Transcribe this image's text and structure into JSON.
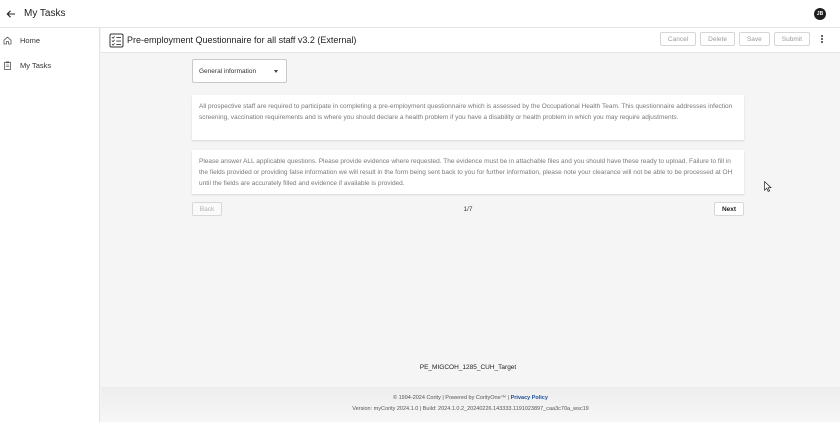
{
  "topbar": {
    "title": "My Tasks",
    "avatar_initials": "JB",
    "back_icon": "arrow-left-icon"
  },
  "sidebar": {
    "items": [
      {
        "label": "Home",
        "icon": "home-icon"
      },
      {
        "label": "My Tasks",
        "icon": "clipboard-icon"
      }
    ]
  },
  "form": {
    "title": "Pre-employment Questionnaire for all staff v3.2 (External)",
    "icon": "form-checklist-icon",
    "actions": {
      "cancel_label": "Cancel",
      "delete_label": "Delete",
      "save_label": "Save",
      "submit_label": "Submit"
    },
    "section_select": {
      "value": "General information"
    },
    "info_text_1": "All prospective staff are required to participate in completing a pre-employment questionnaire which is assessed by the Occupational Health Team. This questionnaire addresses infection screening, vaccination requirements and is where you should declare a health problem if you have a disability or health problem in which you may require adjustments.",
    "info_text_2": "Please answer ALL applicable questions. Please provide evidence where requested. The evidence must be in attachable files and you should have these ready to upload. Failure to fill in the fields provided or providing false information we will result in the form being sent back to you for further information, please note your clearance will not be able to be processed at OH until the fields are accurately filled and evidence if available is provided.",
    "back_label": "Back",
    "next_label": "Next",
    "pager_text": "1/7"
  },
  "target_code": "PE_MIGCOH_1285_CUH_Target",
  "footer": {
    "copyright": "© 1994-2024 Cority | Powered by CorityOne™ | ",
    "privacy_label": "Privacy Policy",
    "version": "Version: myCority 2024.1.0 | Build: 2024.1.0.2_20240226.143333.1191023897_caa3c70a_wsc19"
  },
  "colors": {
    "page_background": "#f5f5f5",
    "link": "#1a4f9c",
    "avatar_background": "#1f1f1f"
  }
}
